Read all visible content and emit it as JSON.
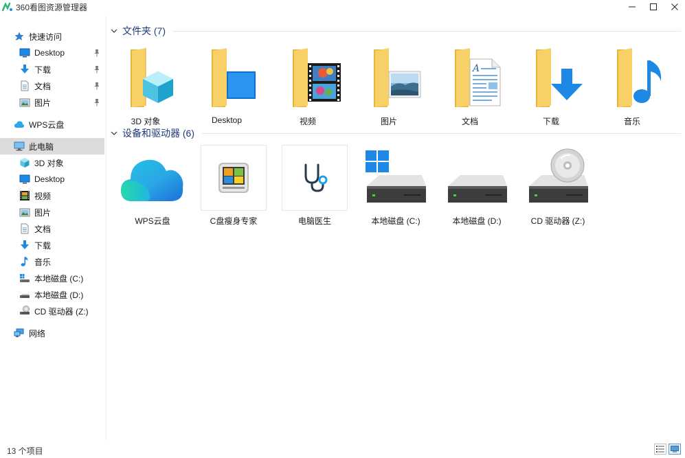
{
  "window": {
    "title": "360看图资源管理器",
    "controls": [
      "minimize",
      "maximize",
      "close"
    ]
  },
  "sidebar": {
    "items": [
      {
        "label": "快速访问",
        "icon": "star-icon",
        "level": 0
      },
      {
        "label": "Desktop",
        "icon": "desktop-icon",
        "level": 1,
        "pinned": true
      },
      {
        "label": "下载",
        "icon": "download-arrow-icon",
        "level": 1,
        "pinned": true
      },
      {
        "label": "文档",
        "icon": "document-icon",
        "level": 1,
        "pinned": true
      },
      {
        "label": "图片",
        "icon": "picture-icon",
        "level": 1,
        "pinned": true
      },
      {
        "label": "WPS云盘",
        "icon": "cloud-icon",
        "level": 0
      },
      {
        "label": "此电脑",
        "icon": "computer-icon",
        "level": 0,
        "selected": true
      },
      {
        "label": "3D 对象",
        "icon": "cube-icon",
        "level": 1
      },
      {
        "label": "Desktop",
        "icon": "desktop-icon",
        "level": 1
      },
      {
        "label": "视频",
        "icon": "film-icon",
        "level": 1
      },
      {
        "label": "图片",
        "icon": "picture-icon",
        "level": 1
      },
      {
        "label": "文档",
        "icon": "document-icon",
        "level": 1
      },
      {
        "label": "下载",
        "icon": "download-arrow-icon",
        "level": 1
      },
      {
        "label": "音乐",
        "icon": "music-note-icon",
        "level": 1
      },
      {
        "label": "本地磁盘 (C:)",
        "icon": "windows-drive-icon",
        "level": 1
      },
      {
        "label": "本地磁盘 (D:)",
        "icon": "drive-icon",
        "level": 1
      },
      {
        "label": "CD 驱动器 (Z:)",
        "icon": "cd-drive-icon",
        "level": 1
      },
      {
        "label": "网络",
        "icon": "network-icon",
        "level": 0
      }
    ]
  },
  "groups": {
    "folders": {
      "title": "文件夹 (7)",
      "items": [
        {
          "label": "3D 对象",
          "icon": "folder-3d-objects-icon"
        },
        {
          "label": "Desktop",
          "icon": "folder-desktop-icon"
        },
        {
          "label": "视频",
          "icon": "folder-videos-icon"
        },
        {
          "label": "图片",
          "icon": "folder-pictures-icon"
        },
        {
          "label": "文档",
          "icon": "folder-documents-icon"
        },
        {
          "label": "下载",
          "icon": "folder-downloads-icon"
        },
        {
          "label": "音乐",
          "icon": "folder-music-icon"
        }
      ]
    },
    "devices": {
      "title": "设备和驱动器 (6)",
      "items": [
        {
          "label": "WPS云盘",
          "icon": "wps-cloud-icon"
        },
        {
          "label": "C盘瘦身专家",
          "icon": "disk-cleanup-icon"
        },
        {
          "label": "电脑医生",
          "icon": "stethoscope-icon"
        },
        {
          "label": "本地磁盘 (C:)",
          "icon": "windows-drive-icon"
        },
        {
          "label": "本地磁盘 (D:)",
          "icon": "drive-icon"
        },
        {
          "label": "CD 驱动器 (Z:)",
          "icon": "cd-drive-icon"
        }
      ]
    }
  },
  "statusbar": {
    "item_count": "13 个项目",
    "views": [
      "details-view",
      "large-icons-view"
    ],
    "active_view": "large-icons-view"
  },
  "colors": {
    "folder_yellow": "#f5c94a",
    "accent_blue": "#1e88e5",
    "group_title": "#1e3a78",
    "selected_bg": "#dcdcdc"
  }
}
